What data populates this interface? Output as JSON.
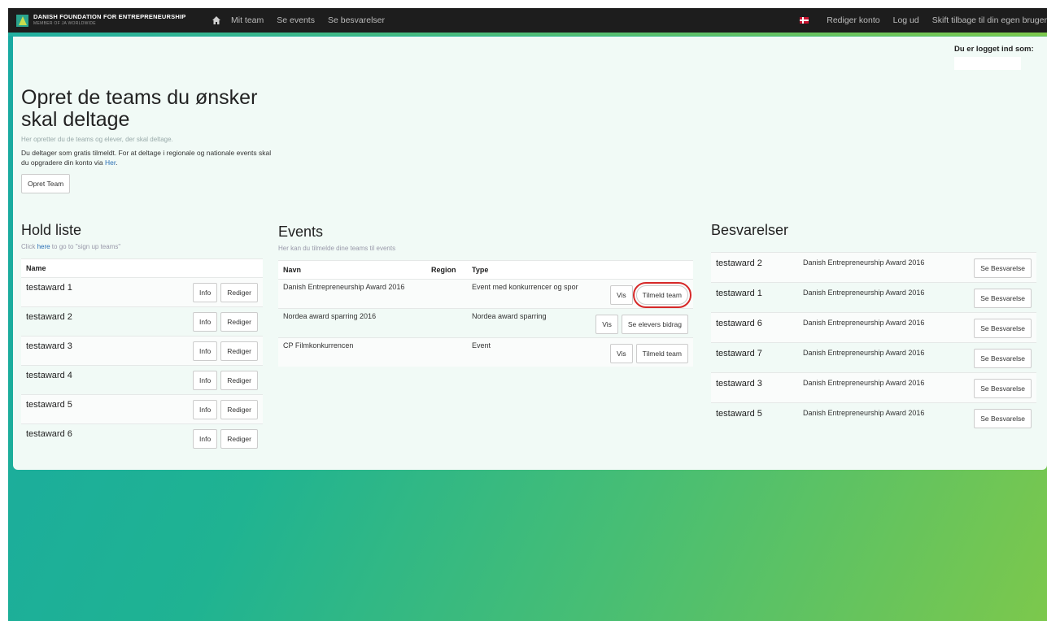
{
  "navbar": {
    "brand_line1": "DANISH FOUNDATION FOR ENTREPRENEURSHIP",
    "brand_line2": "MEMBER OF JA WORLDWIDE",
    "links": [
      "Mit team",
      "Se events",
      "Se besvarelser"
    ],
    "right_links": [
      "Rediger konto",
      "Log ud",
      "Skift tilbage til din egen bruger"
    ]
  },
  "logged_in_label": "Du er logget ind som:",
  "hero": {
    "title": "Opret de teams du ønsker skal deltage",
    "subtitle": "Her opretter du de teams og elever, der skal deltage.",
    "desc_prefix": "Du deltager som gratis tilmeldt. For at deltage i regionale og nationale events skal du opgradere din konto via ",
    "desc_link": "Her",
    "desc_suffix": ".",
    "create_button": "Opret Team"
  },
  "hold": {
    "title": "Hold liste",
    "sub_prefix": "Click ",
    "sub_link": "here",
    "sub_suffix": " to go to \"sign up teams\"",
    "col_name": "Name",
    "info_label": "Info",
    "edit_label": "Rediger",
    "teams": [
      "testaward 1",
      "testaward 2",
      "testaward 3",
      "testaward 4",
      "testaward 5",
      "testaward 6"
    ]
  },
  "events": {
    "title": "Events",
    "sub": "Her kan du tilmelde dine teams til events",
    "col_navn": "Navn",
    "col_region": "Region",
    "col_type": "Type",
    "rows": [
      {
        "name": "Danish Entrepreneurship Award 2016",
        "region": "",
        "type": "Event med konkurrencer og spor",
        "btn1": "Vis",
        "btn2": "Tilmeld team"
      },
      {
        "name": "Nordea award sparring 2016",
        "region": "",
        "type": "Nordea award sparring",
        "btn1": "Vis",
        "btn2": "Se elevers bidrag"
      },
      {
        "name": "CP Filmkonkurrencen",
        "region": "",
        "type": "Event",
        "btn1": "Vis",
        "btn2": "Tilmeld team"
      }
    ]
  },
  "besvarelser": {
    "title": "Besvarelser",
    "button": "Se Besvarelse",
    "rows": [
      {
        "team": "testaward 2",
        "event": "Danish Entrepreneurship Award 2016"
      },
      {
        "team": "testaward 1",
        "event": "Danish Entrepreneurship Award 2016"
      },
      {
        "team": "testaward 6",
        "event": "Danish Entrepreneurship Award 2016"
      },
      {
        "team": "testaward 7",
        "event": "Danish Entrepreneurship Award 2016"
      },
      {
        "team": "testaward 3",
        "event": "Danish Entrepreneurship Award 2016"
      },
      {
        "team": "testaward 5",
        "event": "Danish Entrepreneurship Award 2016"
      }
    ]
  },
  "colors": {
    "accent_link": "#2a6fb5",
    "highlight": "#d62828",
    "navbar": "#1d1d1d"
  }
}
